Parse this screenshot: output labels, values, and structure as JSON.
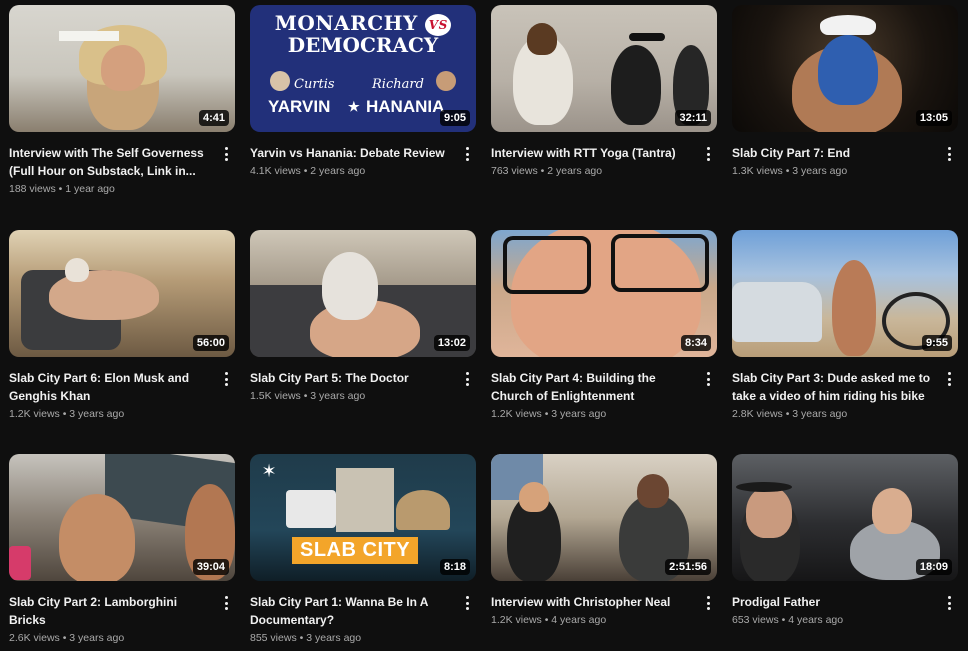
{
  "videos": [
    {
      "title": "Interview with The Self Governess (Full Hour on Substack, Link in...",
      "views": "188 views",
      "age": "1 year ago",
      "duration": "4:41"
    },
    {
      "title": "Yarvin vs Hanania: Debate Review",
      "views": "4.1K views",
      "age": "2 years ago",
      "duration": "9:05",
      "thumb_text": {
        "line1": "MONARCHY",
        "vs": "VS",
        "line2": "DEMOCRACY",
        "left_script": "Curtis",
        "left_bold": "YARVIN",
        "right_script": "Richard",
        "right_bold": "HANANIA",
        "star": "★"
      }
    },
    {
      "title": "Interview with RTT Yoga (Tantra)",
      "views": "763 views",
      "age": "2 years ago",
      "duration": "32:11"
    },
    {
      "title": "Slab City Part 7: End",
      "views": "1.3K views",
      "age": "3 years ago",
      "duration": "13:05"
    },
    {
      "title": "Slab City Part 6: Elon Musk and Genghis Khan",
      "views": "1.2K views",
      "age": "3 years ago",
      "duration": "56:00"
    },
    {
      "title": "Slab City Part 5: The Doctor",
      "views": "1.5K views",
      "age": "3 years ago",
      "duration": "13:02"
    },
    {
      "title": "Slab City Part 4: Building the Church of Enlightenment",
      "views": "1.2K views",
      "age": "3 years ago",
      "duration": "8:34"
    },
    {
      "title": "Slab City Part 3: Dude asked me to take a video of him riding his bike",
      "views": "2.8K views",
      "age": "3 years ago",
      "duration": "9:55"
    },
    {
      "title": "Slab City Part 2: Lamborghini Bricks",
      "views": "2.6K views",
      "age": "3 years ago",
      "duration": "39:04"
    },
    {
      "title": "Slab City Part 1: Wanna Be In A Documentary?",
      "views": "855 views",
      "age": "3 years ago",
      "duration": "8:18",
      "thumb_text": {
        "banner": "SLAB CITY"
      }
    },
    {
      "title": "Interview with Christopher Neal",
      "views": "1.2K views",
      "age": "4 years ago",
      "duration": "2:51:56"
    },
    {
      "title": "Prodigal Father",
      "views": "653 views",
      "age": "4 years ago",
      "duration": "18:09"
    }
  ],
  "separator": " • ",
  "colors": {
    "background": "#0f0f0f",
    "title": "#f1f1f1",
    "meta": "#aaaaaa",
    "duration_bg": "#000000cc"
  }
}
